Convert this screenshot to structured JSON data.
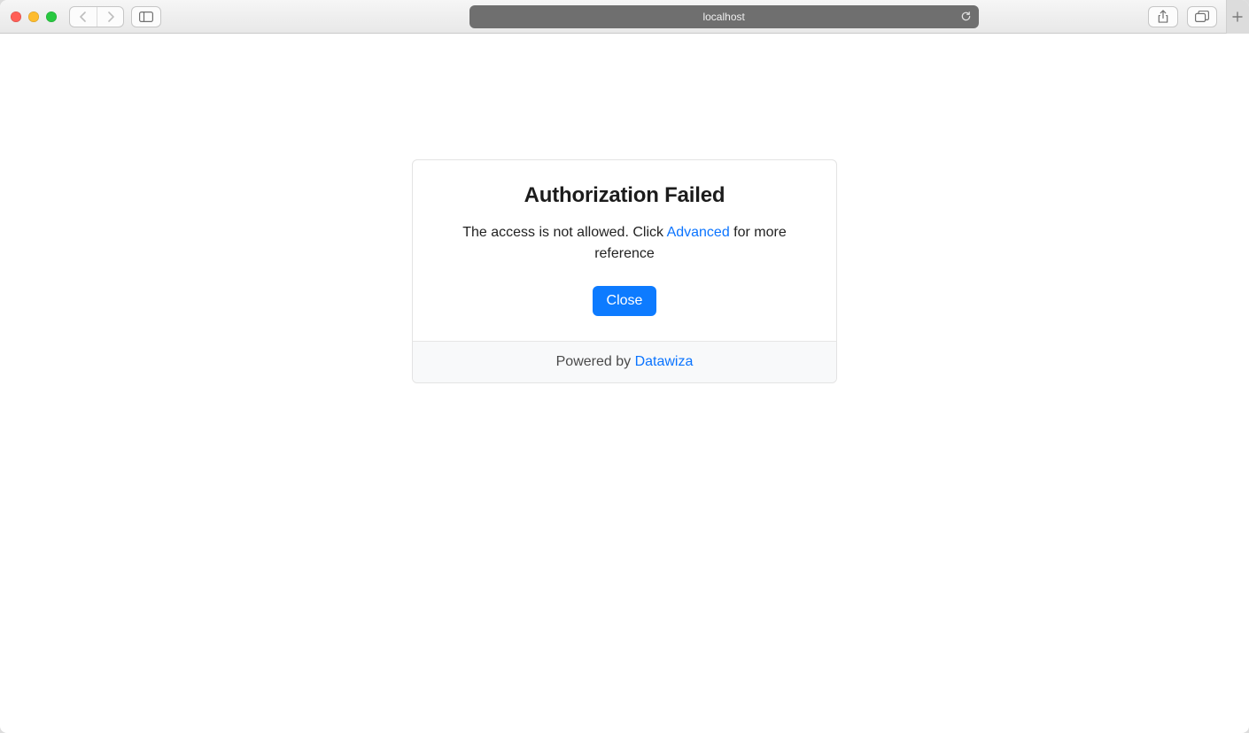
{
  "browser": {
    "url_display": "localhost"
  },
  "dialog": {
    "title": "Authorization Failed",
    "message_prefix": "The access is not allowed. Click ",
    "advanced_link": "Advanced",
    "message_suffix": " for more reference",
    "close_label": "Close",
    "footer_prefix": "Powered by ",
    "footer_link": "Datawiza"
  }
}
